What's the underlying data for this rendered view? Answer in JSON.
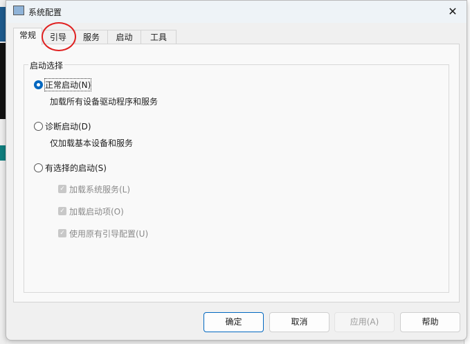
{
  "window": {
    "title": "系统配置"
  },
  "tabs": [
    {
      "label": "常规"
    },
    {
      "label": "引导"
    },
    {
      "label": "服务"
    },
    {
      "label": "启动"
    },
    {
      "label": "工具"
    }
  ],
  "group": {
    "label": "启动选择"
  },
  "options": [
    {
      "label": "正常启动(N)",
      "desc": "加载所有设备驱动程序和服务",
      "selected": true
    },
    {
      "label": "诊断启动(D)",
      "desc": "仅加载基本设备和服务",
      "selected": false
    },
    {
      "label": "有选择的启动(S)",
      "selected": false
    }
  ],
  "checkboxes": [
    {
      "label": "加载系统服务(L)",
      "checked": true,
      "disabled": true
    },
    {
      "label": "加载启动项(O)",
      "checked": true,
      "disabled": true
    },
    {
      "label": "使用原有引导配置(U)",
      "checked": true,
      "disabled": true
    }
  ],
  "buttons": {
    "ok": "确定",
    "cancel": "取消",
    "apply": "应用(A)",
    "help": "帮助"
  },
  "annotation": {
    "color": "#e02020"
  }
}
